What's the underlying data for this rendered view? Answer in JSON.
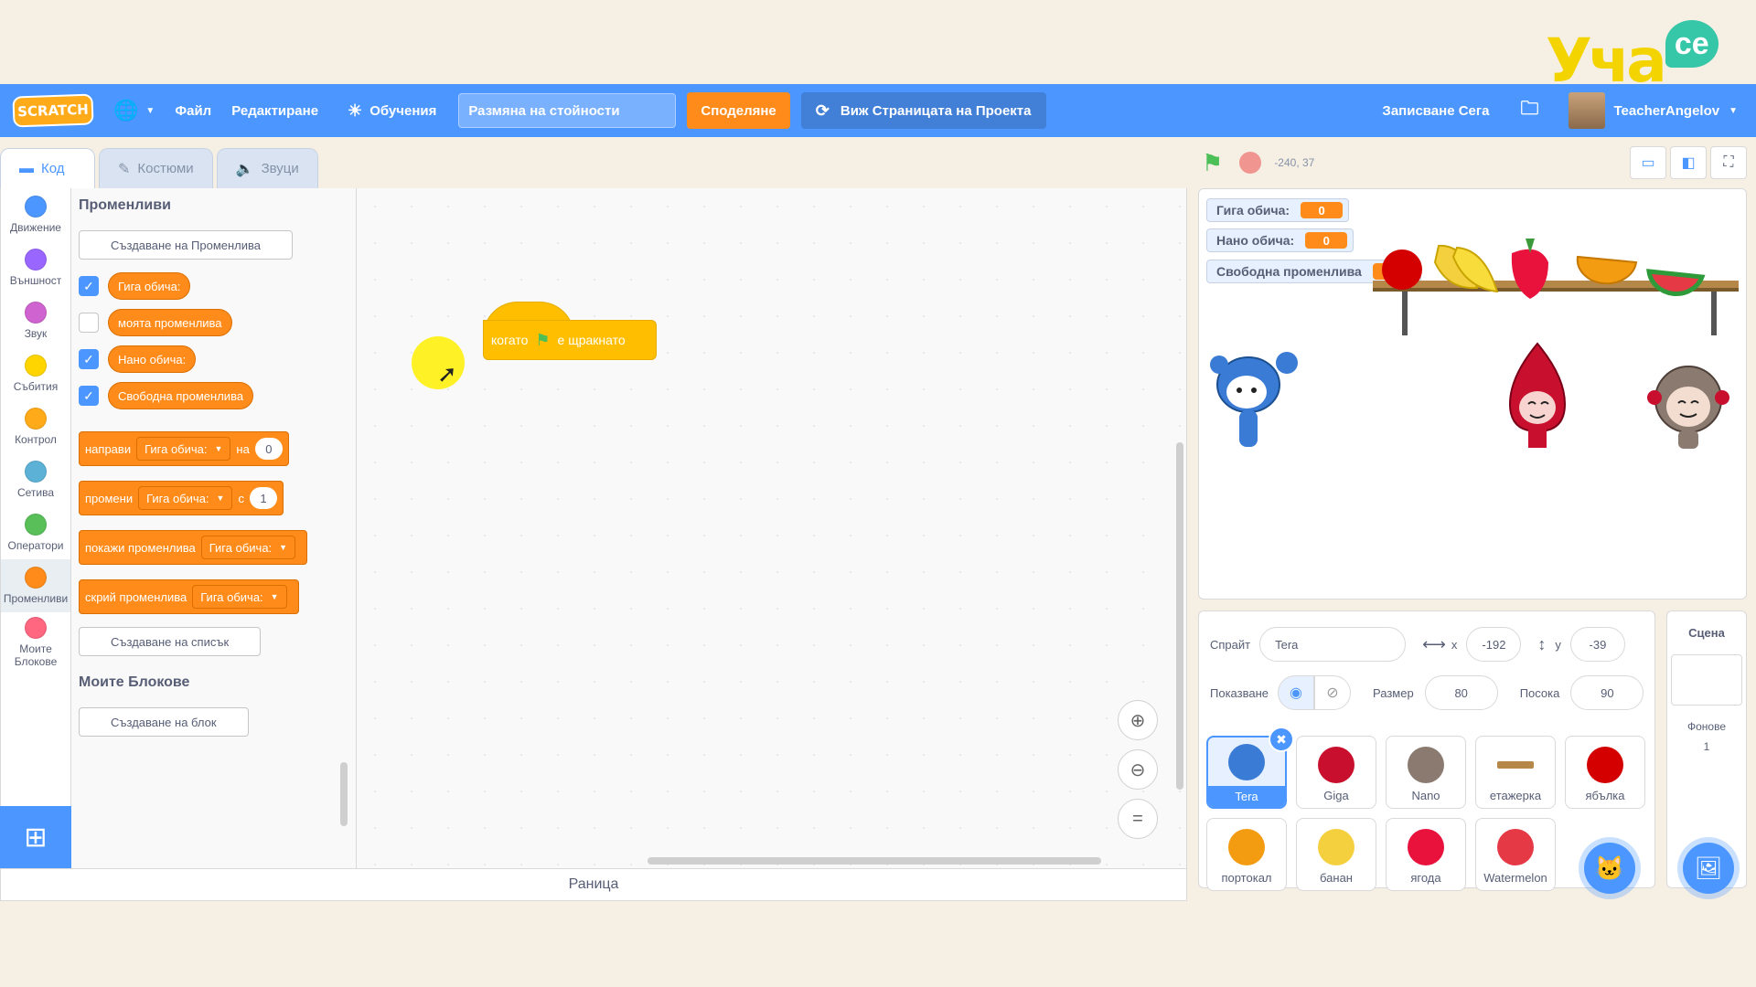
{
  "watermark": {
    "text": "Уча",
    "bubble": "се"
  },
  "menu": {
    "logo": "SCRATCH",
    "file": "Файл",
    "edit": "Редактиране",
    "tutorials": "Обучения",
    "project_title": "Размяна на стойности",
    "share": "Споделяне",
    "see_project": "Виж Страницата на Проекта",
    "save_now": "Записване Сега",
    "username": "TeacherAngelov"
  },
  "tabs": {
    "code": "Код",
    "costumes": "Костюми",
    "sounds": "Звуци"
  },
  "categories": [
    {
      "label": "Движение",
      "color": "#4c97ff"
    },
    {
      "label": "Външност",
      "color": "#9966ff"
    },
    {
      "label": "Звук",
      "color": "#cf63cf"
    },
    {
      "label": "Събития",
      "color": "#ffd500"
    },
    {
      "label": "Контрол",
      "color": "#ffab19"
    },
    {
      "label": "Сетива",
      "color": "#5cb1d6"
    },
    {
      "label": "Оператори",
      "color": "#59c059"
    },
    {
      "label": "Променливи",
      "color": "#ff8c1a"
    },
    {
      "label": "Моите Блокове",
      "color": "#ff6680"
    }
  ],
  "palette": {
    "variables_heading": "Променливи",
    "make_variable": "Създаване на Променлива",
    "variables": [
      {
        "name": "Гига обича:",
        "checked": true
      },
      {
        "name": "моята променлива",
        "checked": false
      },
      {
        "name": "Нано обича:",
        "checked": true
      },
      {
        "name": "Свободна променлива",
        "checked": true
      }
    ],
    "set_block": {
      "word": "направи",
      "var": "Гига обича:",
      "to": "на",
      "value": "0"
    },
    "change_block": {
      "word": "промени",
      "var": "Гига обича:",
      "by": "с",
      "value": "1"
    },
    "show_block": {
      "word": "покажи променлива",
      "var": "Гига обича:"
    },
    "hide_block": {
      "word": "скрий променлива",
      "var": "Гига обича:"
    },
    "make_list": "Създаване на списък",
    "my_blocks_heading": "Моите Блокове",
    "make_block": "Създаване на блок"
  },
  "workspace": {
    "hat_block": {
      "before": "когато",
      "after": "е щракнато"
    }
  },
  "backpack": "Раница",
  "stage": {
    "coords": "-240, 37",
    "monitors": [
      {
        "label": "Гига обича:",
        "value": "0"
      },
      {
        "label": "Нано обича:",
        "value": "0"
      },
      {
        "label": "Свободна променлива",
        "value": "0"
      }
    ]
  },
  "sprite_info": {
    "sprite_label": "Спрайт",
    "sprite_name": "Tera",
    "x_label": "x",
    "x": "-192",
    "y_label": "y",
    "y": "-39",
    "show_label": "Показване",
    "size_label": "Размер",
    "size": "80",
    "direction_label": "Посока",
    "direction": "90"
  },
  "sprites": [
    {
      "name": "Tera",
      "color": "#3a7bd5"
    },
    {
      "name": "Giga",
      "color": "#c8102e"
    },
    {
      "name": "Nano",
      "color": "#8a7a70"
    },
    {
      "name": "етажерка",
      "color": "#b5884a"
    },
    {
      "name": "ябълка",
      "color": "#d40000"
    },
    {
      "name": "портокал",
      "color": "#f39c12"
    },
    {
      "name": "банан",
      "color": "#f4d03f"
    },
    {
      "name": "ягода",
      "color": "#e8123c"
    },
    {
      "name": "Watermelon",
      "color": "#e63946"
    }
  ],
  "scene": {
    "title": "Сцена",
    "backdrops_label": "Фонове",
    "backdrops_count": "1"
  }
}
